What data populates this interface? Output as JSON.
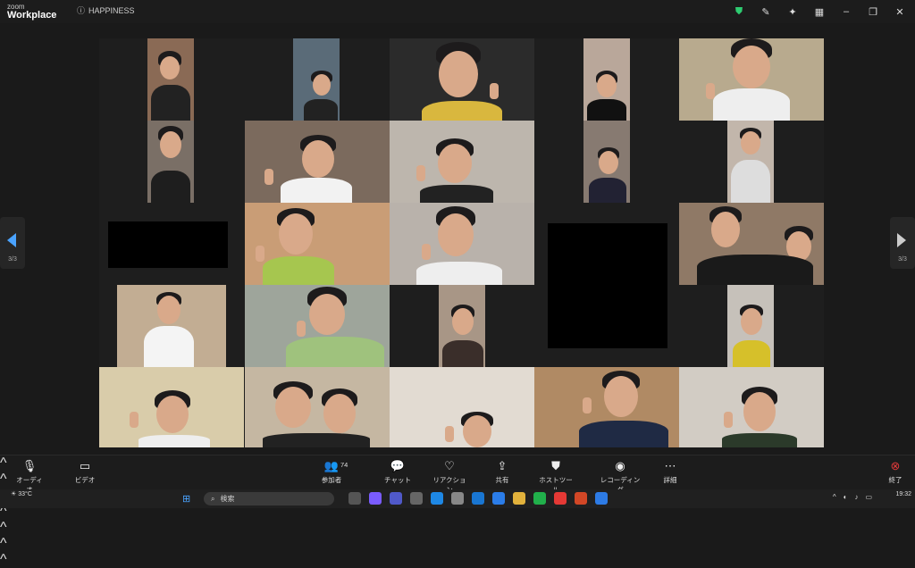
{
  "window": {
    "brand_top": "zoom",
    "brand_bottom": "Workplace",
    "meeting_title": "HAPPINESS"
  },
  "navigation": {
    "left_page": "3/3",
    "right_page": "3/3"
  },
  "toolbar": {
    "audio": "オーディオ",
    "video": "ビデオ",
    "participants": "参加者",
    "participants_count": "74",
    "chat": "チャット",
    "reactions": "リアクション",
    "share": "共有",
    "host_tools": "ホストツール",
    "recording": "レコーディング",
    "more": "詳細",
    "end": "終了"
  },
  "taskbar": {
    "temperature": "33°C",
    "search_placeholder": "検索",
    "time": "19:32"
  },
  "colors": {
    "accent_green": "#2ecc71",
    "end_red": "#e03a3a",
    "nav_blue": "#4aa3ff"
  }
}
